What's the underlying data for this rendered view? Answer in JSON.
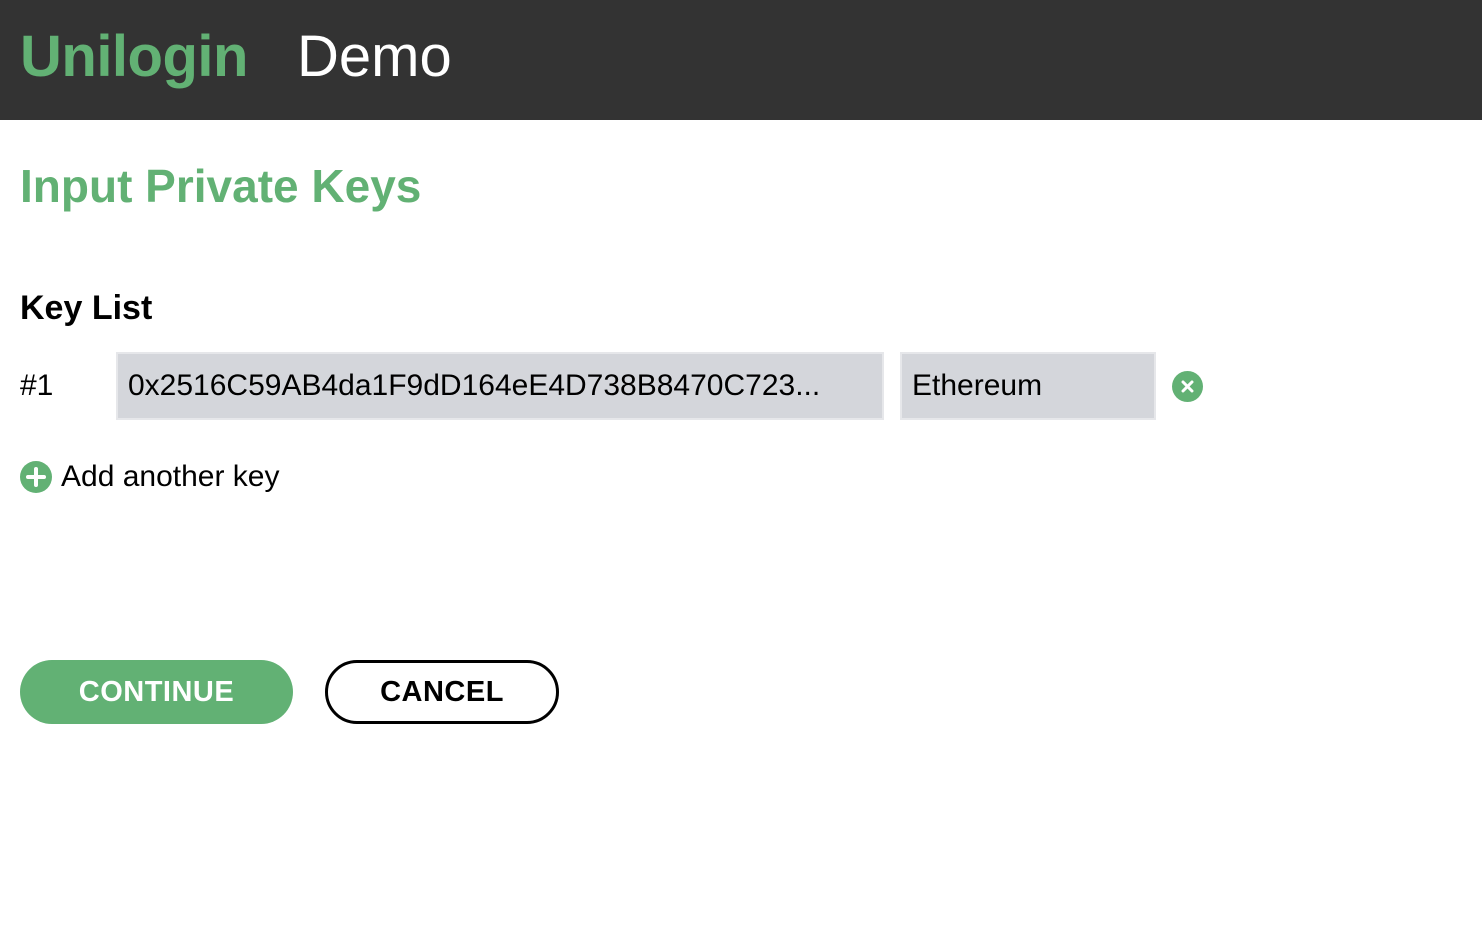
{
  "header": {
    "brand": "Unilogin",
    "subtitle": "Demo"
  },
  "page": {
    "title": "Input Private Keys"
  },
  "key_list": {
    "title": "Key List",
    "rows": [
      {
        "index": "#1",
        "key_value": "0x2516C59AB4da1F9dD164eE4D738B8470C723...",
        "network": "Ethereum",
        "remove_icon": "close-circle-icon"
      }
    ],
    "add_label": "Add another key",
    "add_icon": "plus-circle-icon"
  },
  "actions": {
    "continue_label": "CONTINUE",
    "cancel_label": "CANCEL"
  },
  "colors": {
    "brand_green": "#62b174",
    "header_bg": "#333333",
    "input_bg": "#d4d6db"
  }
}
